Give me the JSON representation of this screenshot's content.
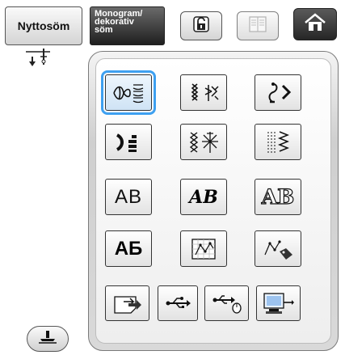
{
  "tabs": {
    "utility_label": "Nyttosöm",
    "monogram_lines": [
      "Monogram/",
      "dekorativ",
      "söm"
    ]
  },
  "header": {
    "icons": [
      "lock-icon",
      "book-icon",
      "home-icon"
    ]
  },
  "stitch_grid": {
    "selected_index": 0,
    "rows": [
      [
        {
          "type": "icon",
          "name": "decorative-stitch-1"
        },
        {
          "type": "icon",
          "name": "decorative-stitch-2"
        },
        {
          "type": "icon",
          "name": "decorative-stitch-3"
        }
      ],
      [
        {
          "type": "icon",
          "name": "satin-stitch"
        },
        {
          "type": "icon",
          "name": "cross-stitch"
        },
        {
          "type": "icon",
          "name": "utility-decorative-stitch"
        }
      ],
      [
        {
          "type": "text",
          "name": "font-gothic",
          "label": "AB"
        },
        {
          "type": "text",
          "name": "font-script",
          "label": "AB"
        },
        {
          "type": "text",
          "name": "font-outline",
          "label": "AB"
        }
      ],
      [
        {
          "type": "text",
          "name": "font-cyrillic",
          "label": "АБ"
        },
        {
          "type": "icon",
          "name": "my-custom-stitch"
        },
        {
          "type": "icon",
          "name": "my-custom-stitch-edit"
        }
      ]
    ],
    "bottom_row": [
      "pocket-icon",
      "usb-icon",
      "usb-media-icon",
      "computer-icon"
    ]
  },
  "colors": {
    "selection": "#3ea0f0",
    "panel": "#d9d9d9"
  }
}
